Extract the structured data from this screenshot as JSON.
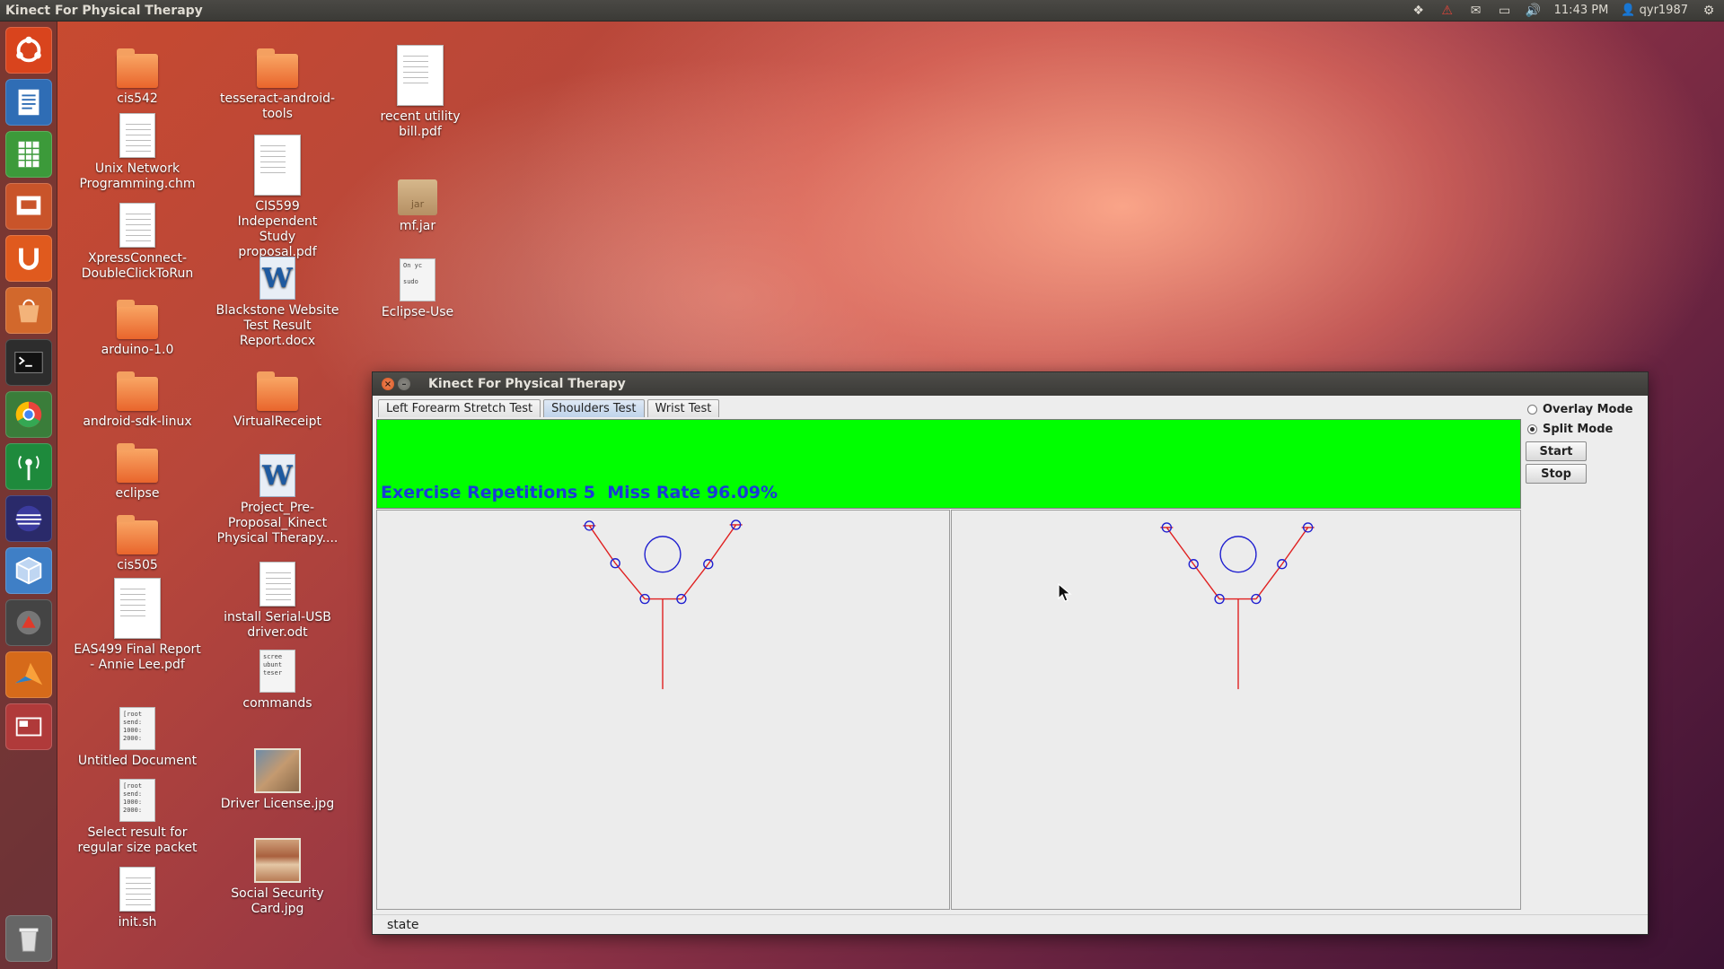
{
  "top_panel": {
    "app_title": "Kinect For Physical Therapy",
    "clock": "11:43 PM",
    "user": "qyr1987",
    "indicator_icons": [
      "dropbox-icon",
      "warning-icon",
      "mail-icon",
      "battery-icon",
      "volume-icon",
      "user-icon",
      "settings-gear-icon"
    ]
  },
  "launcher": {
    "items": [
      {
        "name": "ubuntu-dash-icon",
        "color": "#d9441d"
      },
      {
        "name": "libreoffice-writer-icon",
        "color": "#2f6db5"
      },
      {
        "name": "libreoffice-calc-icon",
        "color": "#3c9a3a"
      },
      {
        "name": "libreoffice-impress-icon",
        "color": "#c9542a"
      },
      {
        "name": "ubuntu-one-icon",
        "color": "#e05a1e"
      },
      {
        "name": "software-center-icon",
        "color": "#d2682c"
      },
      {
        "name": "terminal-icon",
        "color": "#2d2d2d"
      },
      {
        "name": "chrome-icon",
        "color": "#3a7d3a"
      },
      {
        "name": "radio-tower-icon",
        "color": "#1e8a3c"
      },
      {
        "name": "eclipse-icon",
        "color": "#2a2a6a"
      },
      {
        "name": "virtualbox-icon",
        "color": "#3f7fc6"
      },
      {
        "name": "java-app-icon",
        "color": "#444444"
      },
      {
        "name": "matlab-icon",
        "color": "#d66a1a"
      },
      {
        "name": "workspace-switcher-icon",
        "color": "#b03a3a"
      },
      {
        "name": "trash-icon",
        "color": "#666666"
      }
    ]
  },
  "desktop": {
    "icons": [
      {
        "label": "cis542",
        "kind": "folder"
      },
      {
        "label": "Unix Network Programming.chm",
        "kind": "doc"
      },
      {
        "label": "XpressConnect-DoubleClickToRun",
        "kind": "doc"
      },
      {
        "label": "arduino-1.0",
        "kind": "folder"
      },
      {
        "label": "android-sdk-linux",
        "kind": "folder"
      },
      {
        "label": "eclipse",
        "kind": "folder"
      },
      {
        "label": "cis505",
        "kind": "folder"
      },
      {
        "label": "EAS499 Final Report - Annie Lee.pdf",
        "kind": "doc"
      },
      {
        "label": "Untitled Document",
        "kind": "text"
      },
      {
        "label": "Select result for regular size packet",
        "kind": "text"
      },
      {
        "label": "init.sh",
        "kind": "doc"
      },
      {
        "label": "tesseract-android-tools",
        "kind": "folder"
      },
      {
        "label": "CIS599 Independent Study proposal.pdf",
        "kind": "doc"
      },
      {
        "label": "Blackstone Website Test Result Report.docx",
        "kind": "word"
      },
      {
        "label": "VirtualReceipt",
        "kind": "folder"
      },
      {
        "label": "Project_Pre-Proposal_Kinect Physical Therapy....",
        "kind": "word"
      },
      {
        "label": "install Serial-USB driver.odt",
        "kind": "doc"
      },
      {
        "label": "commands",
        "kind": "text"
      },
      {
        "label": "Driver License.jpg",
        "kind": "photo"
      },
      {
        "label": "Social Security Card.jpg",
        "kind": "photo"
      },
      {
        "label": "recent utility bill.pdf",
        "kind": "doc"
      },
      {
        "label": "mf.jar",
        "kind": "jar"
      },
      {
        "label": "Eclipse-Use",
        "kind": "text"
      }
    ],
    "text_previews": {
      "untitled": "[root\nsend:\n1000:\n2000:",
      "select_result": "[root\nsend:\n1000:\n2000:",
      "commands": "scree\nubunt\nteser",
      "eclipse_use": "On yc\n\nsudo",
      "jar_label": "jar"
    }
  },
  "window": {
    "title": "Kinect For Physical Therapy",
    "tabs": [
      {
        "label": "Left Forearm Stretch Test",
        "active": false
      },
      {
        "label": "Shoulders Test",
        "active": true
      },
      {
        "label": "Wrist Test",
        "active": false
      }
    ],
    "banner": {
      "color": "#00ff00",
      "stats_text": "Exercise Repetitions 5  Miss Rate 96.09%"
    },
    "modes": [
      {
        "label": "Overlay Mode",
        "checked": false
      },
      {
        "label": "Split Mode",
        "checked": true
      }
    ],
    "buttons": {
      "start": "Start",
      "stop": "Stop"
    },
    "statusbar": "state",
    "skeleton_color": "#e02020",
    "joint_color": "#2020d0"
  }
}
